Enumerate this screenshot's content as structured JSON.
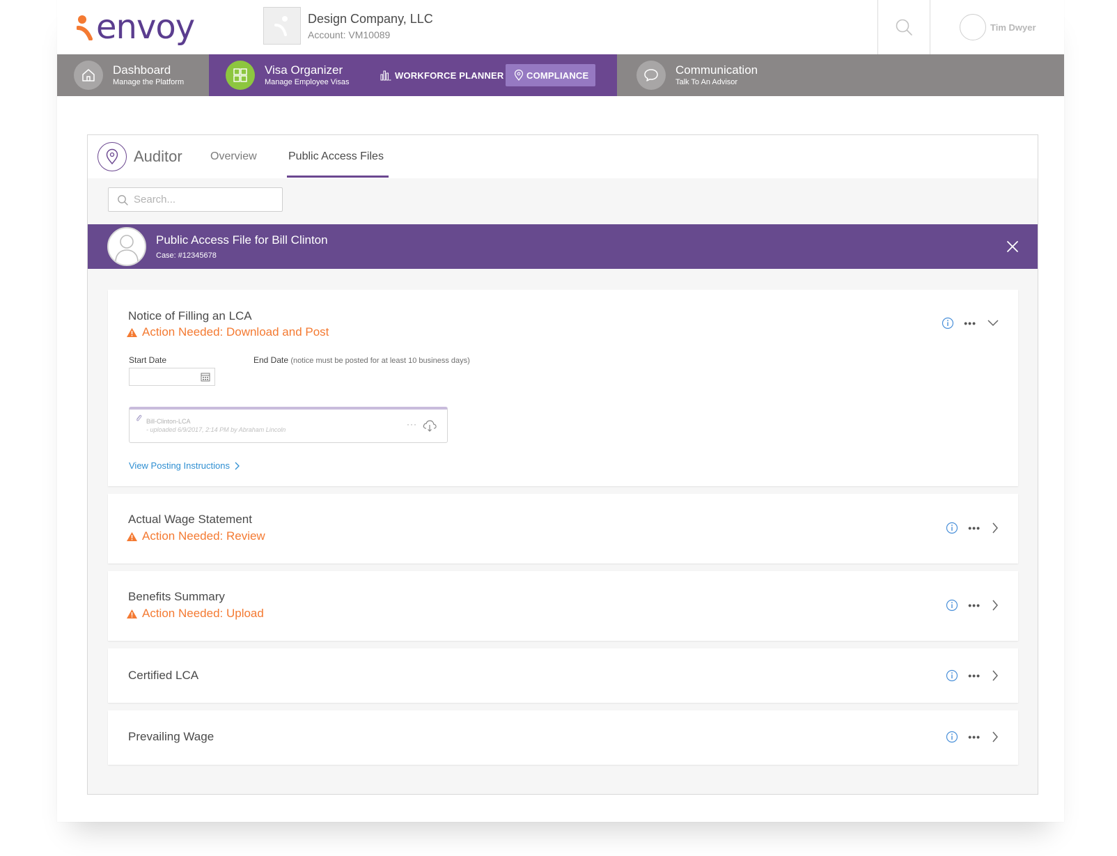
{
  "brand": {
    "logo_text": "envoy",
    "accent": "#6b4790",
    "logo_orange": "#f47a32"
  },
  "company": {
    "name": "Design Company, LLC",
    "account": "Account: VM10089"
  },
  "user": {
    "name": "Tim Dwyer"
  },
  "nav": {
    "dashboard": {
      "title": "Dashboard",
      "subtitle": "Manage the Platform",
      "icon": "home-icon"
    },
    "visa": {
      "title": "Visa Organizer",
      "subtitle": "Manage Employee Visas",
      "icon": "grid-icon",
      "icon_bg": "#8dc63f"
    },
    "workforce": {
      "label": "WORKFORCE PLANNER",
      "icon": "bar-chart-icon"
    },
    "compliance": {
      "label": "COMPLIANCE",
      "icon": "location-pin-icon"
    },
    "communication": {
      "title": "Communication",
      "subtitle": "Talk To An Advisor",
      "icon": "chat-icon"
    }
  },
  "auditor": {
    "title": "Auditor",
    "tabs": [
      {
        "label": "Overview"
      },
      {
        "label": "Public Access Files",
        "active": true
      }
    ],
    "search_placeholder": "Search..."
  },
  "paf": {
    "title": "Public Access File for Bill Clinton",
    "case": "Case: #12345678"
  },
  "panels": [
    {
      "title": "Notice of Filling an LCA",
      "alert": "Action Needed: Download and Post",
      "expanded": true,
      "start_date_label": "Start Date",
      "end_date_label": "End Date",
      "end_date_hint": "(notice must be posted for at least 10 business days)",
      "file": {
        "name": "Bill-Clinton-LCA",
        "meta": "- uploaded 6/9/2017, 2:14 PM by Abraham Lincoln"
      },
      "link": "View Posting Instructions"
    },
    {
      "title": "Actual Wage Statement",
      "alert": "Action Needed: Review"
    },
    {
      "title": "Benefits Summary",
      "alert": "Action Needed: Upload"
    },
    {
      "title": "Certified LCA",
      "alert": ""
    },
    {
      "title": "Prevailing Wage",
      "alert": ""
    }
  ],
  "more_label": "•••",
  "file_more_label": "···"
}
